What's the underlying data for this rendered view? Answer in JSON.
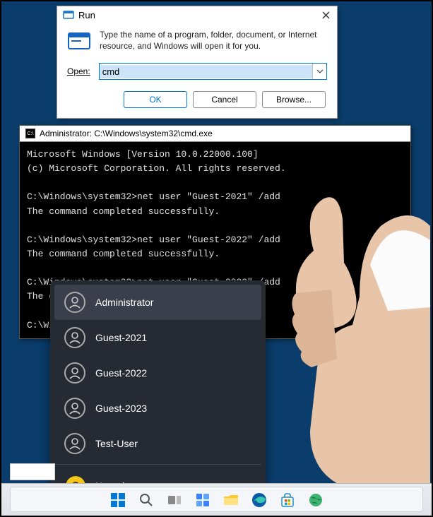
{
  "run": {
    "title": "Run",
    "description": "Type the name of a program, folder, document, or Internet resource, and Windows will open it for you.",
    "open_label": "Open:",
    "input_value": "cmd",
    "ok": "OK",
    "cancel": "Cancel",
    "browse": "Browse..."
  },
  "cmd": {
    "title": "Administrator: C:\\Windows\\system32\\cmd.exe",
    "lines": [
      "Microsoft Windows [Version 10.0.22000.100]",
      "(c) Microsoft Corporation. All rights reserved.",
      "",
      "C:\\Windows\\system32>net user \"Guest-2021\" /add",
      "The command completed successfully.",
      "",
      "C:\\Windows\\system32>net user \"Guest-2022\" /add",
      "The command completed successfully.",
      "",
      "C:\\Windows\\system32>net user \"Guest-2023\" /add",
      "The command completed successfully.",
      "",
      "C:\\Windows\\system32>"
    ]
  },
  "start": {
    "users": [
      {
        "label": "Administrator",
        "highlighted": true
      },
      {
        "label": "Guest-2021",
        "highlighted": false
      },
      {
        "label": "Guest-2022",
        "highlighted": false
      },
      {
        "label": "Guest-2023",
        "highlighted": false
      },
      {
        "label": "Test-User",
        "highlighted": false
      }
    ],
    "current_user": "Nenad"
  },
  "taskbar": {
    "icons": [
      "start",
      "search",
      "taskview",
      "widgets",
      "explorer",
      "edge",
      "store",
      "settings"
    ]
  }
}
